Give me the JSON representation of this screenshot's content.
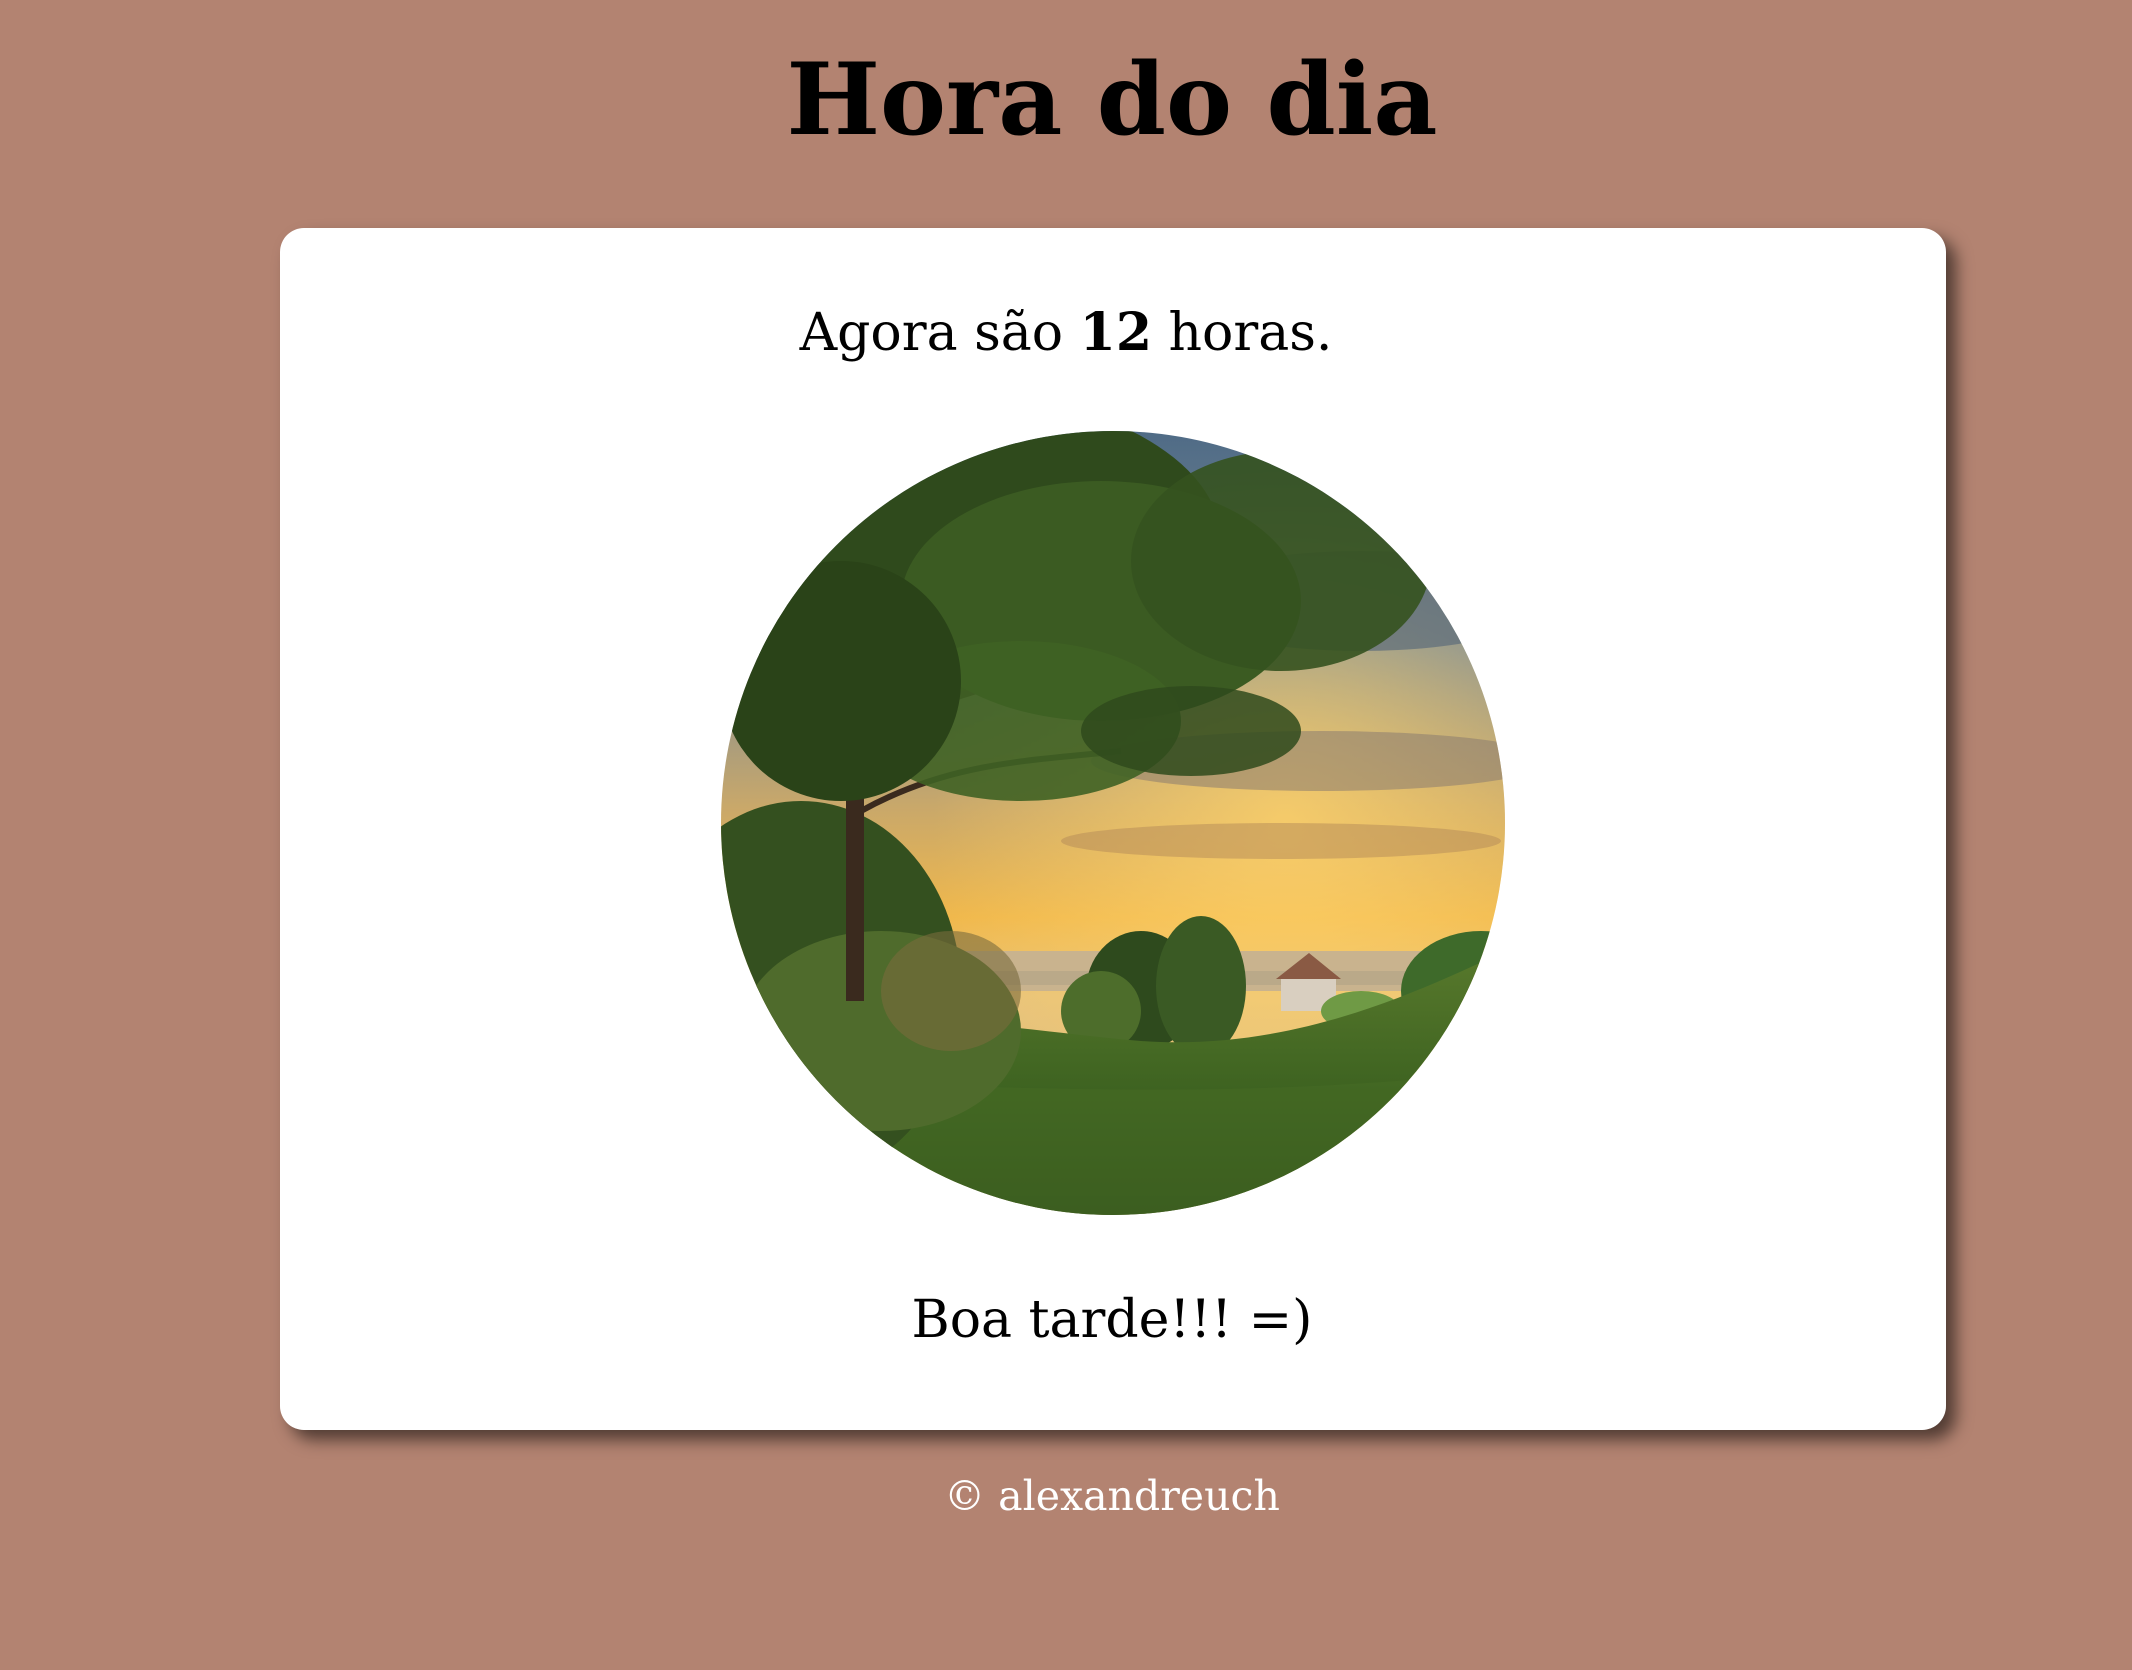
{
  "page": {
    "title": "Hora do dia",
    "background_color": "#b38371"
  },
  "card": {
    "time_prefix": "Agora são",
    "hour": "12",
    "time_suffix": "horas.",
    "image_description_icon": "landscape-photo",
    "greeting": "Boa tarde!!! =)"
  },
  "footer": {
    "text": "© alexandreuch"
  }
}
